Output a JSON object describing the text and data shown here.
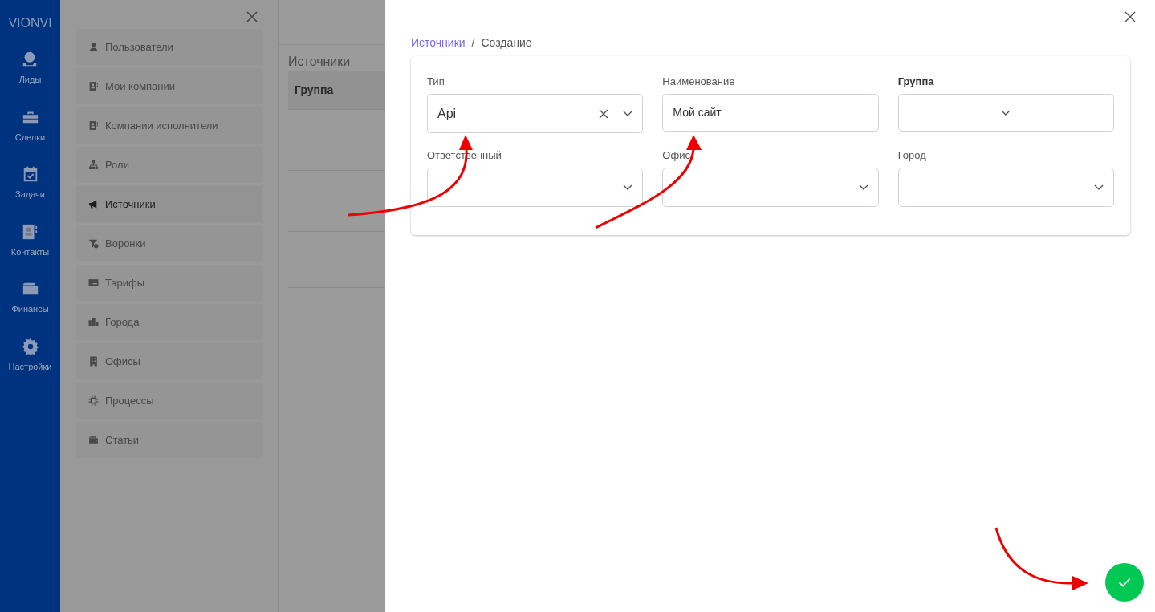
{
  "sidebar": {
    "logo": "VIONVI",
    "items": [
      {
        "label": "Лиды"
      },
      {
        "label": "Сделки"
      },
      {
        "label": "Задачи"
      },
      {
        "label": "Контакты"
      },
      {
        "label": "Финансы"
      },
      {
        "label": "Настройки"
      }
    ]
  },
  "settings_menu": {
    "items": [
      {
        "label": "Пользователи",
        "selected": false
      },
      {
        "label": "Мои компании",
        "selected": false
      },
      {
        "label": "Компании исполнители",
        "selected": false
      },
      {
        "label": "Роли",
        "selected": false
      },
      {
        "label": "Источники",
        "selected": true
      },
      {
        "label": "Воронки",
        "selected": false
      },
      {
        "label": "Тарифы",
        "selected": false
      },
      {
        "label": "Города",
        "selected": false
      },
      {
        "label": "Офисы",
        "selected": false
      },
      {
        "label": "Процессы",
        "selected": false
      },
      {
        "label": "Статьи",
        "selected": false
      }
    ]
  },
  "background_page": {
    "title": "Источники",
    "table": {
      "columns": [
        "Группа"
      ]
    }
  },
  "drawer": {
    "breadcrumb": {
      "link": "Источники",
      "separator": "/",
      "current": "Создание"
    },
    "fields": [
      {
        "label": "Тип",
        "kind": "select",
        "value": "Api",
        "clearable": true,
        "emphasized": false
      },
      {
        "label": "Наименование",
        "kind": "text",
        "value": "Мой сайт",
        "clearable": false,
        "emphasized": false
      },
      {
        "label": "Группа",
        "kind": "select",
        "clearable": false,
        "emphasized": true
      },
      {
        "label": "Ответственный",
        "kind": "select",
        "clearable": false,
        "emphasized": false
      },
      {
        "label": "Офис",
        "kind": "select",
        "clearable": false,
        "emphasized": false
      },
      {
        "label": "Город",
        "kind": "select",
        "clearable": false,
        "emphasized": false
      }
    ]
  }
}
